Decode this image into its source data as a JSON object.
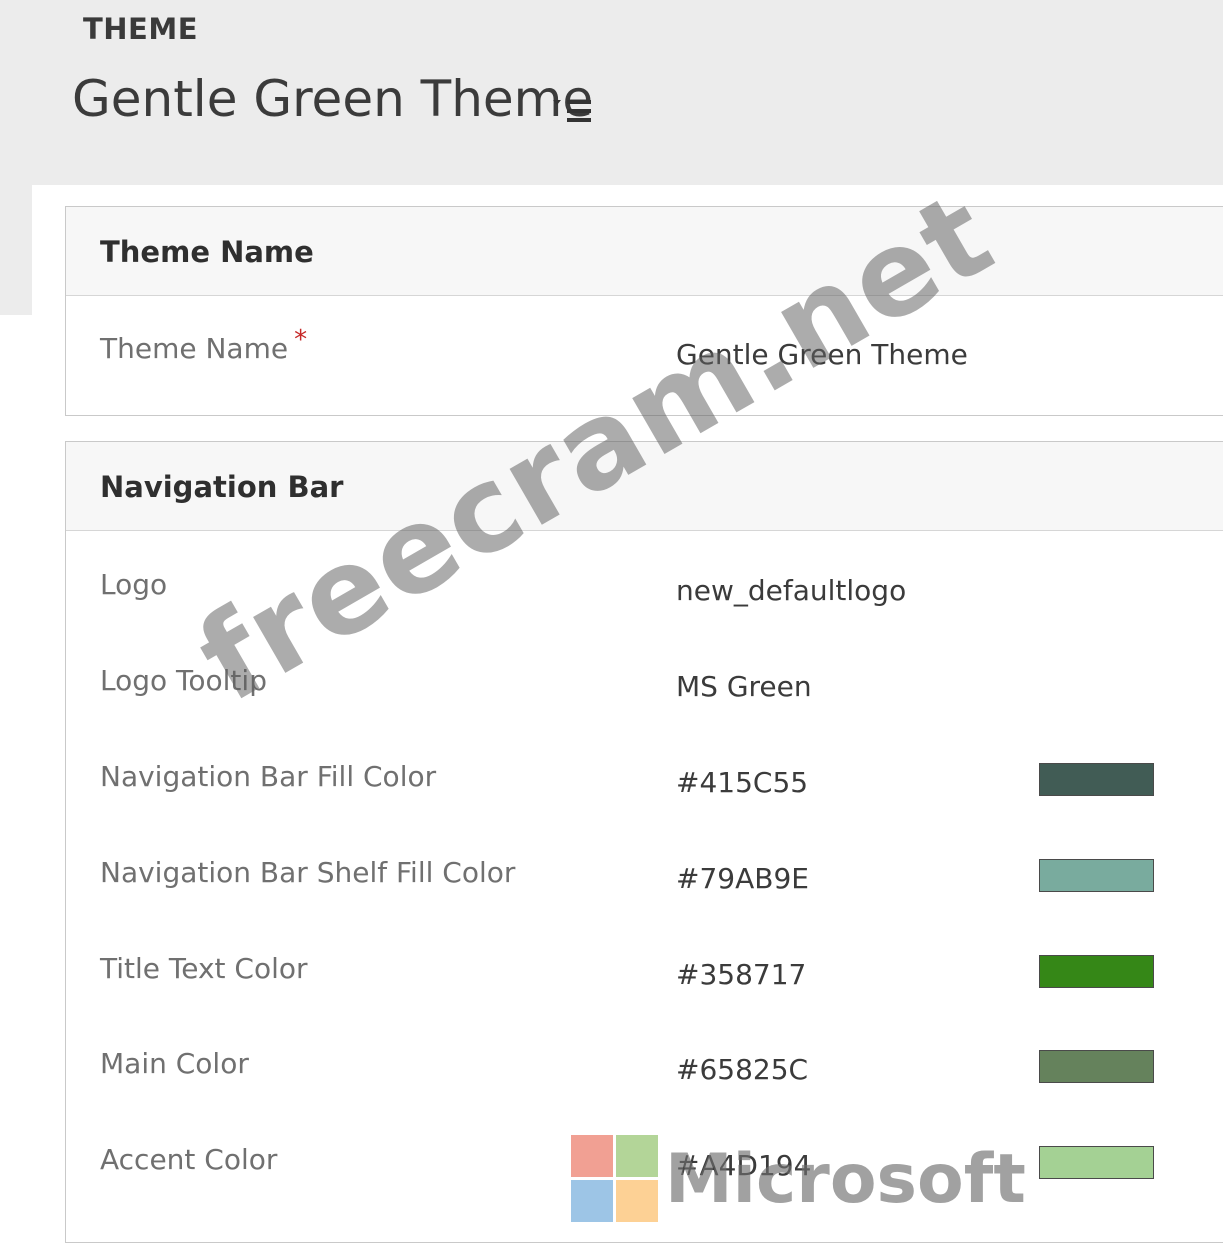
{
  "header": {
    "entity_label": "THEME",
    "record_title": "Gentle Green Theme",
    "menu_icon": "list-menu-icon"
  },
  "sections": {
    "theme_name": {
      "title": "Theme Name",
      "fields": {
        "name": {
          "label": "Theme Name",
          "required_mark": "*",
          "value": "Gentle Green Theme"
        }
      }
    },
    "navigation_bar": {
      "title": "Navigation Bar",
      "fields": {
        "logo": {
          "label": "Logo",
          "value": "new_defaultlogo"
        },
        "logo_tooltip": {
          "label": "Logo Tooltip",
          "value": "MS Green"
        },
        "nav_fill": {
          "label": "Navigation Bar Fill Color",
          "value": "#415C55",
          "color": "#415C55"
        },
        "nav_shelf_fill": {
          "label": "Navigation Bar Shelf Fill Color",
          "value": "#79AB9E",
          "color": "#79AB9E"
        },
        "title_text": {
          "label": "Title Text Color",
          "value": "#358717",
          "color": "#358717"
        },
        "main_color": {
          "label": "Main Color",
          "value": "#65825C",
          "color": "#65825C"
        },
        "accent_color": {
          "label": "Accent Color",
          "value": "#A4D194",
          "color": "#A4D194"
        }
      }
    }
  },
  "watermarks": {
    "site": "freecram.net",
    "brand": "Microsoft",
    "brand_colors": [
      "#F1A093",
      "#B3D598",
      "#9DC5E6",
      "#FDD195"
    ]
  }
}
